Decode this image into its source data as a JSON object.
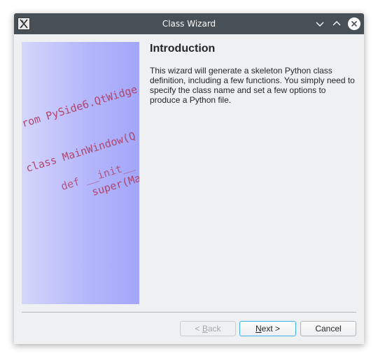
{
  "window": {
    "title": "Class Wizard",
    "app_icon": "wizard-app-icon",
    "controls": [
      "minimize-icon",
      "maximize-icon",
      "close-icon"
    ]
  },
  "watermark": {
    "code_lines": [
      "rom PySide6.QtWidge",
      "class MainWindow(Q",
      "def __init__",
      "super(Ma"
    ],
    "code_color": "#b0456d",
    "gradient": [
      "#d4d6fb",
      "#a3a6f9"
    ]
  },
  "page": {
    "heading": "Introduction",
    "description": "This wizard will generate a skeleton Python class definition, including a few functions. You simply need to specify the class name and set a few options to produce a Python file."
  },
  "buttons": {
    "back": {
      "prefix": "< ",
      "mnemonic": "B",
      "rest": "ack",
      "enabled": false
    },
    "next": {
      "mnemonic": "N",
      "rest": "ext >",
      "enabled": true
    },
    "cancel": {
      "label": "Cancel",
      "enabled": true
    }
  },
  "colors": {
    "titlebar": "#475057",
    "window_bg": "#eff0f1",
    "focus_accent": "#3daee9"
  }
}
